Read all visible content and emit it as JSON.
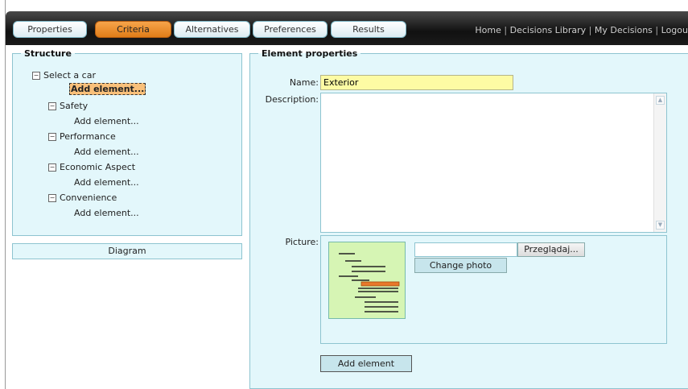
{
  "nav": {
    "tabs": [
      {
        "label": "Properties"
      },
      {
        "label": "Criteria"
      },
      {
        "label": "Alternatives"
      },
      {
        "label": "Preferences"
      },
      {
        "label": "Results"
      }
    ],
    "active_tab": "Criteria",
    "links": [
      "Home",
      "Decisions Library",
      "My Decisions",
      "Logou"
    ],
    "link_separator": "|"
  },
  "structure": {
    "legend": "Structure",
    "root": "Select a car",
    "add_element": "Add element...",
    "children": [
      "Safety",
      "Performance",
      "Economic Aspect",
      "Convenience"
    ],
    "toggle_symbol": "−"
  },
  "diagram_button": "Diagram",
  "properties": {
    "legend": "Element properties",
    "name_label": "Name:",
    "name_value": "Exterior",
    "description_label": "Description:",
    "picture_label": "Picture:",
    "browse_label": "Przeglądaj...",
    "change_photo_label": "Change photo",
    "add_button": "Add element"
  },
  "colors": {
    "active_tab": "#e58a26",
    "panel_bg": "#e3f7fb",
    "name_field_bg": "#fdfba4",
    "thumbnail_bg": "#d6f5b4"
  }
}
